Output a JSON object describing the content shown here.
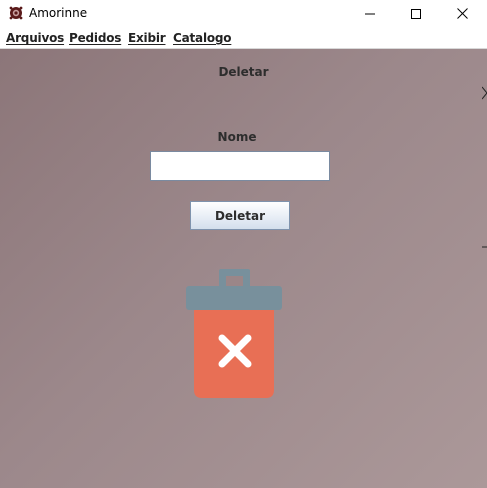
{
  "window": {
    "title": "Amorinne"
  },
  "menu": {
    "items": [
      {
        "label": "Arquivos"
      },
      {
        "label": "Pedidos"
      },
      {
        "label": "Exibir"
      },
      {
        "label": "Catalogo"
      }
    ]
  },
  "form": {
    "heading": "Deletar",
    "nome_label": "Nome",
    "nome_value": "",
    "delete_button_label": "Deletar"
  },
  "icons": {
    "app": "app-logo-icon",
    "trash": "trash-delete-icon",
    "minimize": "minimize-icon",
    "maximize": "maximize-icon",
    "close": "close-icon"
  },
  "colors": {
    "background_start": "#8c7679",
    "background_end": "#ab9899",
    "trash_lid": "#78909c",
    "trash_body": "#e86f55",
    "button_border": "#7f93ad"
  }
}
